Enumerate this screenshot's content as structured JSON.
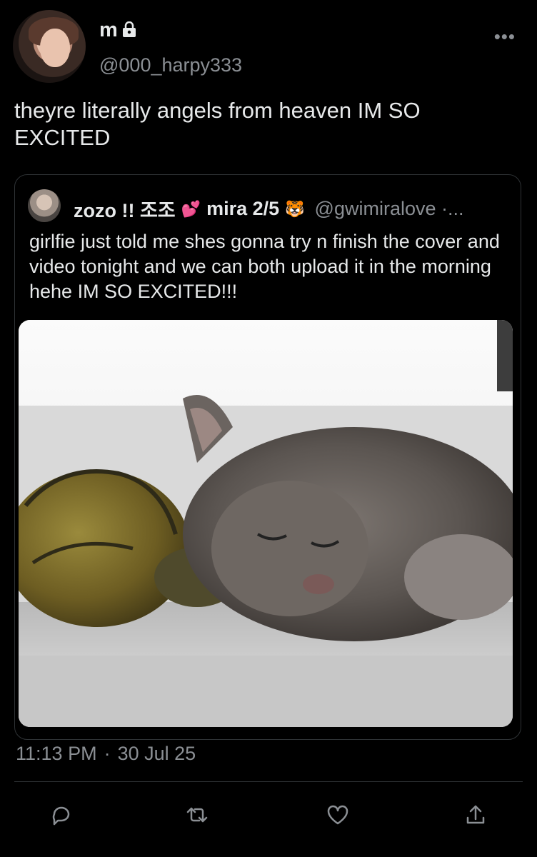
{
  "tweet": {
    "display_name": "m",
    "handle": "@000_harpy333",
    "text": "theyre literally angels from heaven IM SO EXCITED",
    "time": "11:13 PM",
    "separator": "·",
    "date": "30 Jul 25"
  },
  "quote": {
    "name": "zozo !! 조조",
    "name_emoji": "💕",
    "name2": "mira 2/5",
    "name2_emoji": "🐯",
    "handle": "@gwimiralove ·...",
    "text": "girlfie just told me shes gonna try n finish the cover and video tonight and we can both upload it in the morning hehe IM SO EXCITED!!!"
  },
  "icons": {
    "lock": "lock-icon",
    "more": "more-icon",
    "reply": "reply-icon",
    "retweet": "retweet-icon",
    "like": "heart-icon",
    "share": "share-icon"
  },
  "colors": {
    "background": "#000000",
    "text": "#e7e9ea",
    "secondary": "#8b8f94",
    "border": "#2f3336"
  }
}
